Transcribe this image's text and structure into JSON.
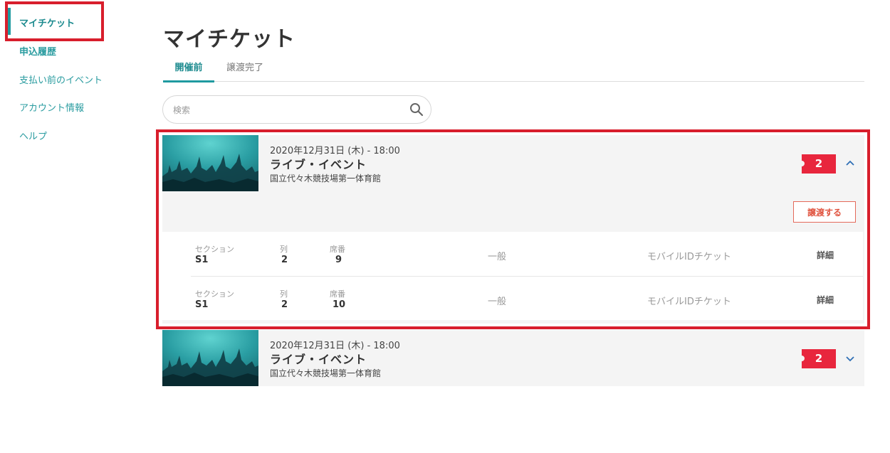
{
  "sidebar": {
    "items": [
      {
        "label": "マイチケット"
      },
      {
        "label": "申込履歴"
      },
      {
        "label": "支払い前のイベント"
      },
      {
        "label": "アカウント情報"
      },
      {
        "label": "ヘルプ"
      }
    ]
  },
  "main": {
    "title": "マイチケット",
    "tabs": [
      {
        "label": "開催前"
      },
      {
        "label": "譲渡完了"
      }
    ],
    "search": {
      "placeholder": "検索",
      "icon": "search-icon"
    }
  },
  "events": [
    {
      "date": "2020年12月31日 (木) - 18:00",
      "title": "ライブ・イベント",
      "venue": "国立代々木競技場第一体育館",
      "ticket_count": "2",
      "transfer_label": "譲渡する",
      "tickets": [
        {
          "section_label": "セクション",
          "section": "S1",
          "row_label": "列",
          "row": "2",
          "seat_label": "席番",
          "seat": "9",
          "type": "一般",
          "delivery": "モバイルIDチケット",
          "detail": "詳細"
        },
        {
          "section_label": "セクション",
          "section": "S1",
          "row_label": "列",
          "row": "2",
          "seat_label": "席番",
          "seat": "10",
          "type": "一般",
          "delivery": "モバイルIDチケット",
          "detail": "詳細"
        }
      ]
    },
    {
      "date": "2020年12月31日 (木) - 18:00",
      "title": "ライブ・イベント",
      "venue": "国立代々木競技場第一体育館",
      "ticket_count": "2"
    }
  ],
  "colors": {
    "accent": "#1f9aa0",
    "ticket_badge": "#e8263d",
    "highlight_box": "#d81e2c"
  }
}
